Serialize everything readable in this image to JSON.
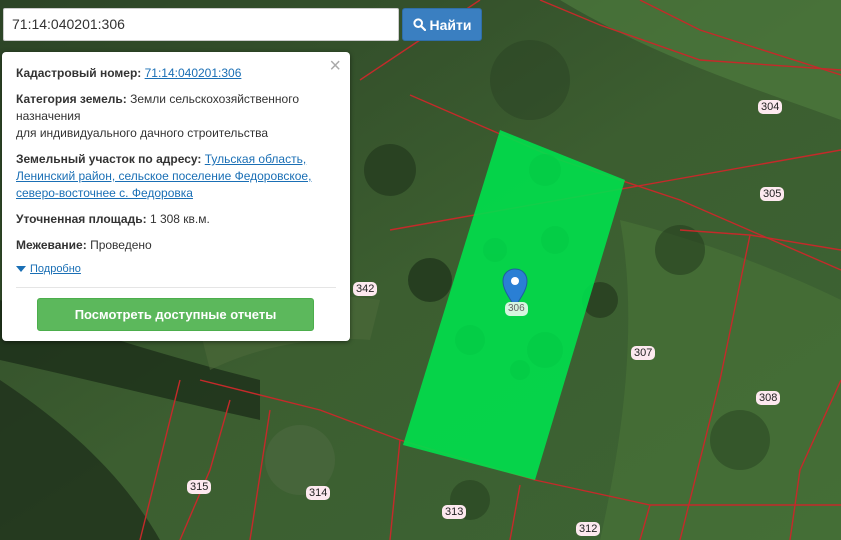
{
  "search": {
    "value": "71:14:040201:306",
    "button_label": "Найти"
  },
  "popup": {
    "cadastral_label": "Кадастровый номер:",
    "cadastral_value": "71:14:040201:306",
    "category_label": "Категория земель:",
    "category_value": "Земли сельскохозяйственного назначения",
    "category_value_2": "для индивидуального дачного строительства",
    "address_label": "Земельный участок по адресу:",
    "address_value": "Тульская область, Ленинский район, сельское поселение Федоровское, северо-восточнее с. Федоровка",
    "area_label": "Уточненная площадь:",
    "area_value": "1 308 кв.м.",
    "survey_label": "Межевание:",
    "survey_value": "Проведено",
    "more_link": "Подробно",
    "reports_button": "Посмотреть доступные отчеты",
    "close_symbol": "×"
  },
  "map": {
    "selected_plot_label": "306",
    "plot_labels": [
      "304",
      "305",
      "342",
      "307",
      "308",
      "315",
      "314",
      "313",
      "312"
    ],
    "selected_fill_color": "#00e04c",
    "boundary_color": "#c42a2a"
  }
}
